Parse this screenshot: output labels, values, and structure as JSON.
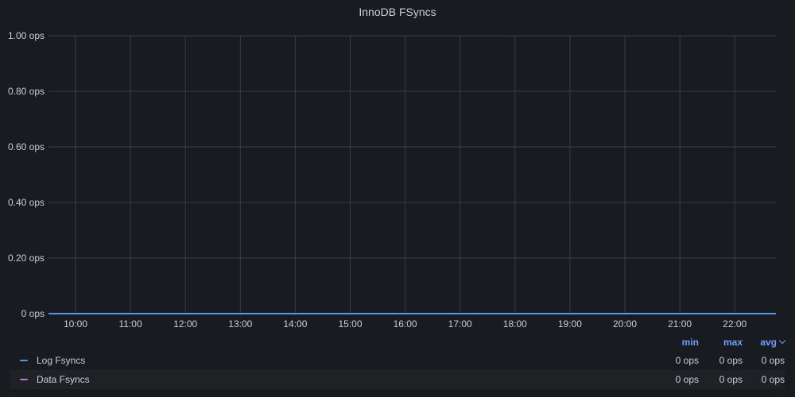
{
  "panel": {
    "title": "InnoDB FSyncs"
  },
  "colors": {
    "background": "#181b1f",
    "grid": "#3a3d42",
    "text": "#ccccdc",
    "legend_header": "#6e9fff"
  },
  "chart_data": {
    "type": "line",
    "title": "InnoDB FSyncs",
    "xlabel": "",
    "ylabel": "",
    "ylim": [
      0,
      1
    ],
    "y_ticks": [
      "0 ops",
      "0.20 ops",
      "0.40 ops",
      "0.60 ops",
      "0.80 ops",
      "1.00 ops"
    ],
    "y_tick_values": [
      0,
      0.2,
      0.4,
      0.6,
      0.8,
      1.0
    ],
    "x": [
      "10:00",
      "11:00",
      "12:00",
      "13:00",
      "14:00",
      "15:00",
      "16:00",
      "17:00",
      "18:00",
      "19:00",
      "20:00",
      "21:00",
      "22:00"
    ],
    "grid": true,
    "legend_placement": "bottom",
    "series": [
      {
        "name": "Log Fsyncs",
        "color": "#5794f2",
        "values": [
          0,
          0,
          0,
          0,
          0,
          0,
          0,
          0,
          0,
          0,
          0,
          0,
          0
        ]
      },
      {
        "name": "Data Fsyncs",
        "color": "#b877d9",
        "values": [
          0,
          0,
          0,
          0,
          0,
          0,
          0,
          0,
          0,
          0,
          0,
          0,
          0
        ]
      }
    ]
  },
  "legend": {
    "headers": {
      "min": "min",
      "max": "max",
      "avg": "avg"
    },
    "rows": [
      {
        "name": "Log Fsyncs",
        "min": "0 ops",
        "max": "0 ops",
        "avg": "0 ops"
      },
      {
        "name": "Data Fsyncs",
        "min": "0 ops",
        "max": "0 ops",
        "avg": "0 ops"
      }
    ]
  }
}
